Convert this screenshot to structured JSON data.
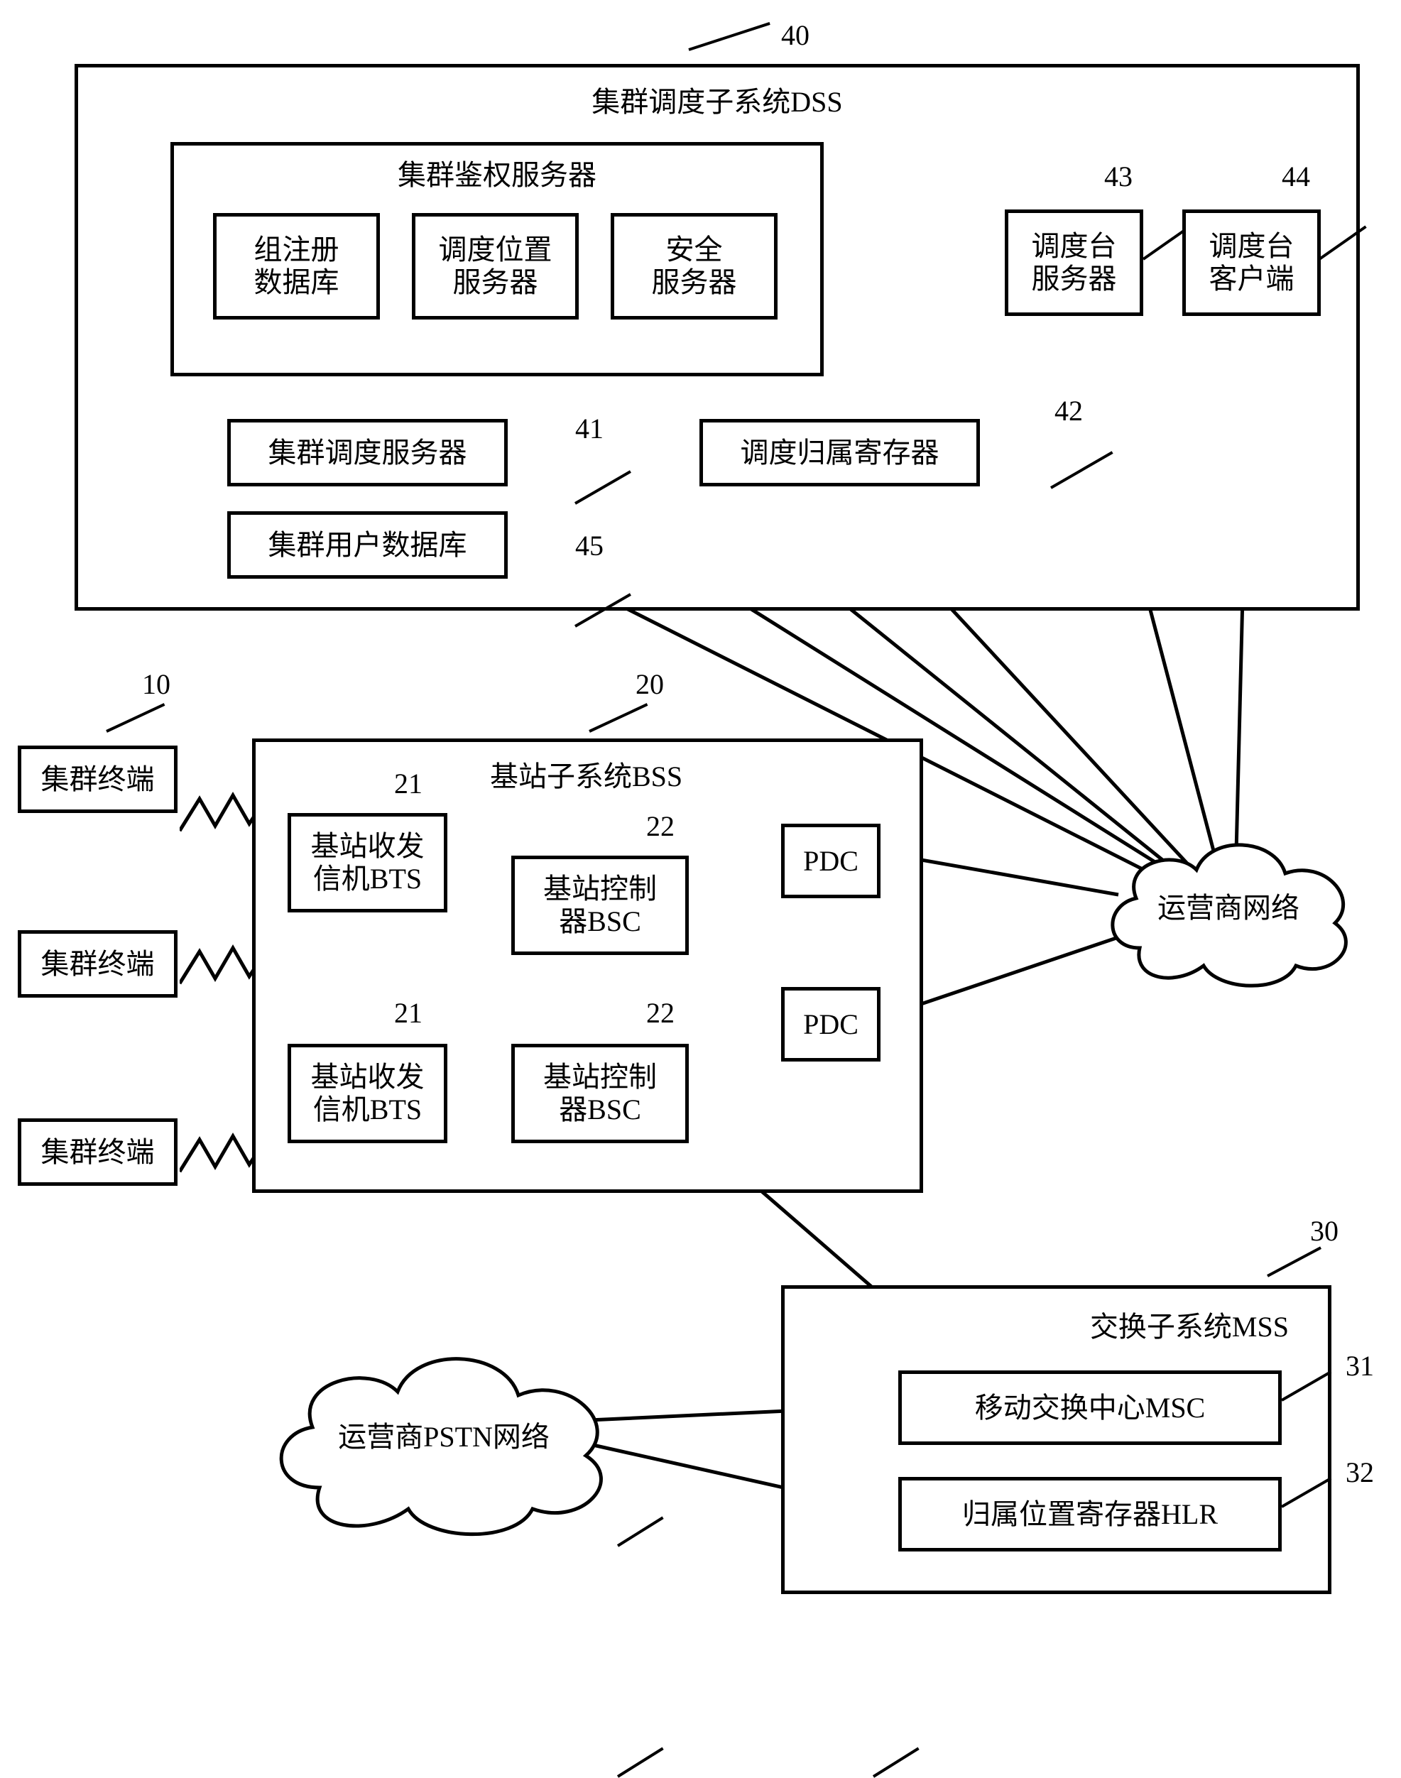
{
  "dss": {
    "ref": "40",
    "title": "集群调度子系统DSS",
    "auth_server": {
      "title": "集群鉴权服务器",
      "group_reg_db": "组注册\n数据库",
      "dispatch_loc_server": "调度位置\n服务器",
      "security_server": "安全\n服务器"
    },
    "dispatch_server_box": {
      "ref": "43",
      "label": "调度台\n服务器"
    },
    "dispatch_client_box": {
      "ref": "44",
      "label": "调度台\n客户端"
    },
    "cluster_dispatch_server": {
      "ref": "41",
      "label": "集群调度服务器"
    },
    "dispatch_home_register": {
      "ref": "42",
      "label": "调度归属寄存器"
    },
    "cluster_user_db": {
      "ref": "45",
      "label": "集群用户数据库"
    }
  },
  "terminals": {
    "ref": "10",
    "label": "集群终端"
  },
  "bss": {
    "ref": "20",
    "title": "基站子系统BSS",
    "bts": {
      "ref": "21",
      "label": "基站收发\n信机BTS"
    },
    "bsc": {
      "ref": "22",
      "label": "基站控制\n器BSC"
    },
    "pdc": {
      "label": "PDC"
    }
  },
  "mss": {
    "ref": "30",
    "title": "交换子系统MSS",
    "msc": {
      "ref": "31",
      "label": "移动交换中心MSC"
    },
    "hlr": {
      "ref": "32",
      "label": "归属位置寄存器HLR"
    }
  },
  "operator_network": {
    "label": "运营商网络"
  },
  "pstn_network": {
    "label": "运营商PSTN网络"
  }
}
